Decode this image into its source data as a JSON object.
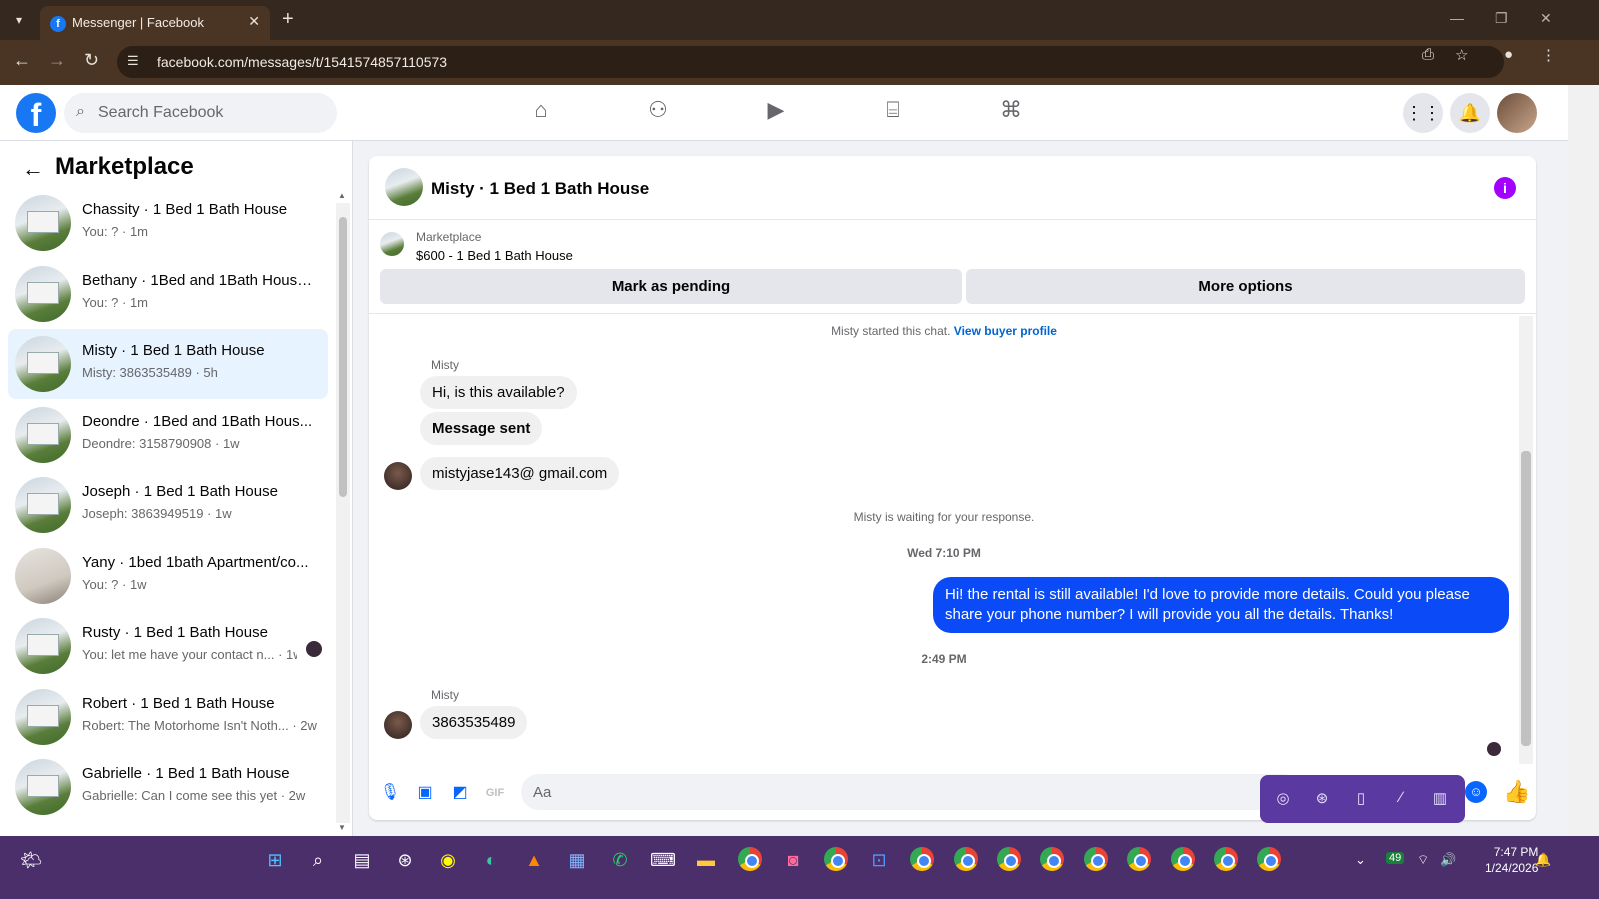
{
  "browser": {
    "tab_title": "Messenger | Facebook",
    "url": "facebook.com/messages/t/1541574857110573"
  },
  "header": {
    "search_placeholder": "Search Facebook"
  },
  "sidebar": {
    "title": "Marketplace",
    "conversations": [
      {
        "name": "Chassity · 1 Bed 1 Bath House",
        "preview": "You: ? · 1m"
      },
      {
        "name": "Bethany · 1Bed and 1Bath House...",
        "preview": "You: ? · 1m"
      },
      {
        "name": "Misty · 1 Bed 1 Bath House",
        "preview": "Misty: 3863535489 · 5h"
      },
      {
        "name": "Deondre · 1Bed and 1Bath Hous...",
        "preview": "Deondre: 3158790908 · 1w"
      },
      {
        "name": "Joseph · 1 Bed 1 Bath House",
        "preview": "Joseph: 3863949519 · 1w"
      },
      {
        "name": "Yany · 1bed 1bath Apartment/co...",
        "preview": "You: ? · 1w"
      },
      {
        "name": "Rusty · 1 Bed 1 Bath House",
        "preview": "You: let me have your contact n... · 1w"
      },
      {
        "name": "Robert · 1 Bed 1 Bath House",
        "preview": "Robert: The Motorhome Isn't Noth... · 2w"
      },
      {
        "name": "Gabrielle · 1 Bed 1 Bath House",
        "preview": "Gabrielle: Can I come see this yet · 2w"
      }
    ]
  },
  "chat": {
    "title": "Misty · 1 Bed 1 Bath House",
    "listing_source": "Marketplace",
    "listing_title": "$600 - 1 Bed 1 Bath House",
    "mark_pending": "Mark as pending",
    "more_options": "More options",
    "started_note": "Misty started this chat.",
    "buyer_profile": "View buyer profile",
    "sender_name": "Misty",
    "msg1": "Hi, is this available?",
    "msg2": "Message sent",
    "msg3": "mistyjase143@ gmail.com",
    "waiting_note": "Misty is waiting for your response.",
    "time1": "Wed 7:10 PM",
    "reply": "Hi! the rental is still available! I'd love to provide more details. Could you please share your phone number? I will provide you all the details. Thanks!",
    "time2": "2:49 PM",
    "msg4": "3863535489",
    "composer_placeholder": "Aa"
  },
  "taskbar": {
    "time": "7:47 PM",
    "date": "1/24/2026",
    "battery": "49"
  }
}
